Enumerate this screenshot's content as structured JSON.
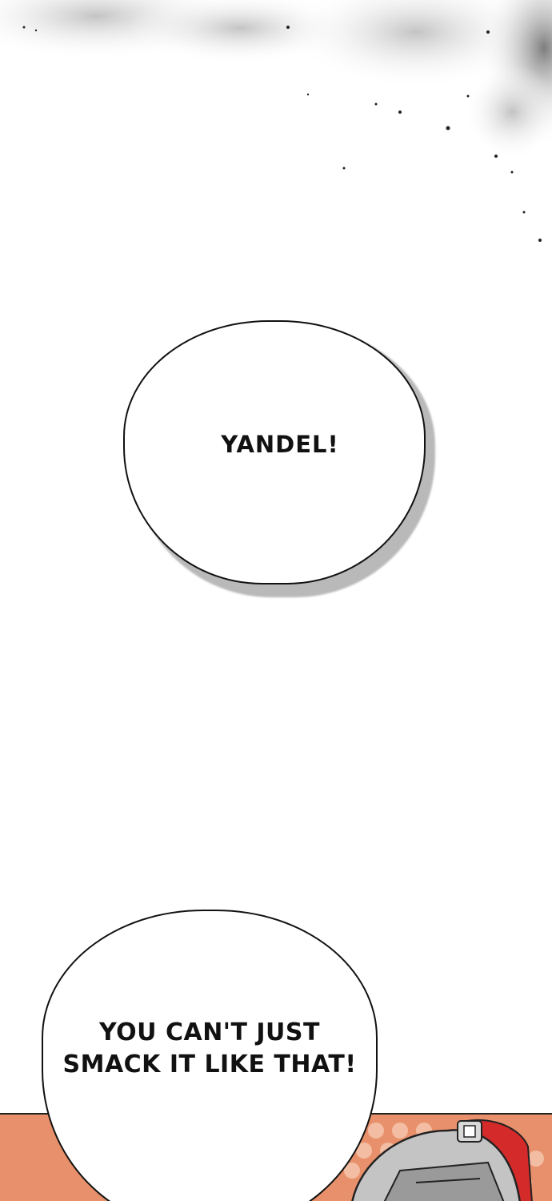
{
  "bubbles": {
    "first": {
      "text": "YANDEL!"
    },
    "second": {
      "line1": "YOU CAN'T JUST",
      "line2": "SMACK IT LIKE THAT!"
    }
  },
  "colors": {
    "panel_background": "#e8906b",
    "bubble_fill": "#ffffff",
    "outline": "#111111",
    "helmet_plume": "#d42a2a",
    "helmet_metal": "#b8b8b8"
  },
  "icons": {
    "top_texture": "smoke-speckle-icon",
    "character": "armored-helmet-icon"
  }
}
